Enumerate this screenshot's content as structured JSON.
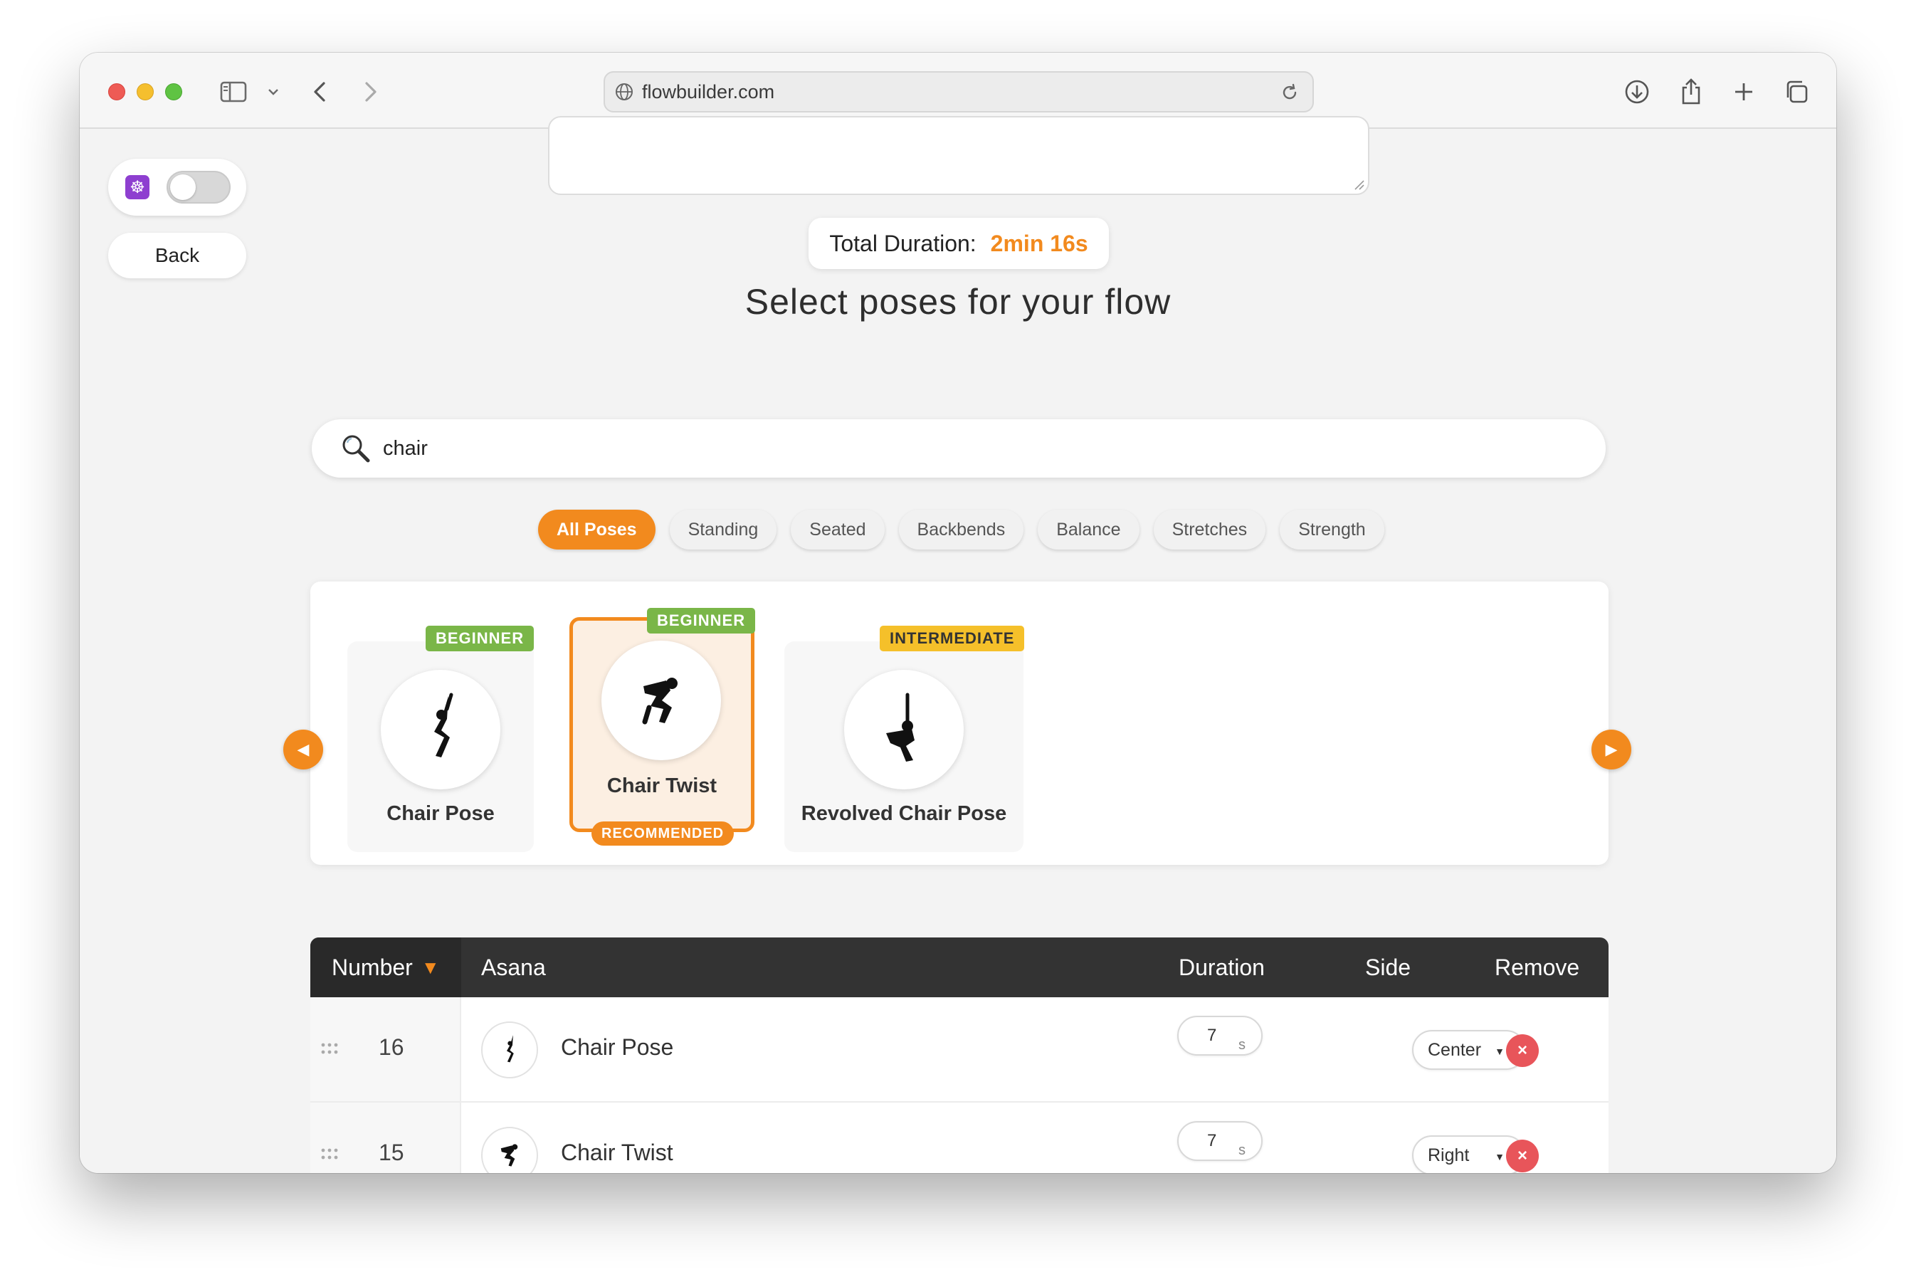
{
  "browser": {
    "url": "flowbuilder.com"
  },
  "sidebar": {
    "om_icon": "☸",
    "toggle_on": false,
    "back_label": "Back"
  },
  "summary": {
    "total_duration_label": "Total Duration:",
    "total_duration_value": "2min 16s"
  },
  "heading": "Select poses for your flow",
  "search": {
    "value": "chair",
    "placeholder": ""
  },
  "filters": [
    {
      "label": "All Poses",
      "active": true
    },
    {
      "label": "Standing",
      "active": false
    },
    {
      "label": "Seated",
      "active": false
    },
    {
      "label": "Backbends",
      "active": false
    },
    {
      "label": "Balance",
      "active": false
    },
    {
      "label": "Stretches",
      "active": false
    },
    {
      "label": "Strength",
      "active": false
    }
  ],
  "carousel": {
    "prev_icon": "◀",
    "next_icon": "▶",
    "poses": [
      {
        "name": "Chair Pose",
        "level": "BEGINNER",
        "recommended": false
      },
      {
        "name": "Chair Twist",
        "level": "BEGINNER",
        "recommended": true,
        "recommended_label": "RECOMMENDED"
      },
      {
        "name": "Revolved Chair Pose",
        "level": "INTERMEDIATE",
        "recommended": false
      }
    ]
  },
  "table": {
    "headers": {
      "number": "Number",
      "sort_icon": "▼",
      "asana": "Asana",
      "duration": "Duration",
      "side": "Side",
      "remove": "Remove"
    },
    "rows": [
      {
        "number": "16",
        "asana": "Chair Pose",
        "duration": "7",
        "unit": "s",
        "side": "Center"
      },
      {
        "number": "15",
        "asana": "Chair Twist",
        "duration": "7",
        "unit": "s",
        "side": "Right"
      }
    ]
  },
  "colors": {
    "accent": "#f28a1e",
    "beginner": "#7ab648",
    "intermediate": "#f5c02a",
    "remove": "#e8555a",
    "table_header": "#333333"
  }
}
